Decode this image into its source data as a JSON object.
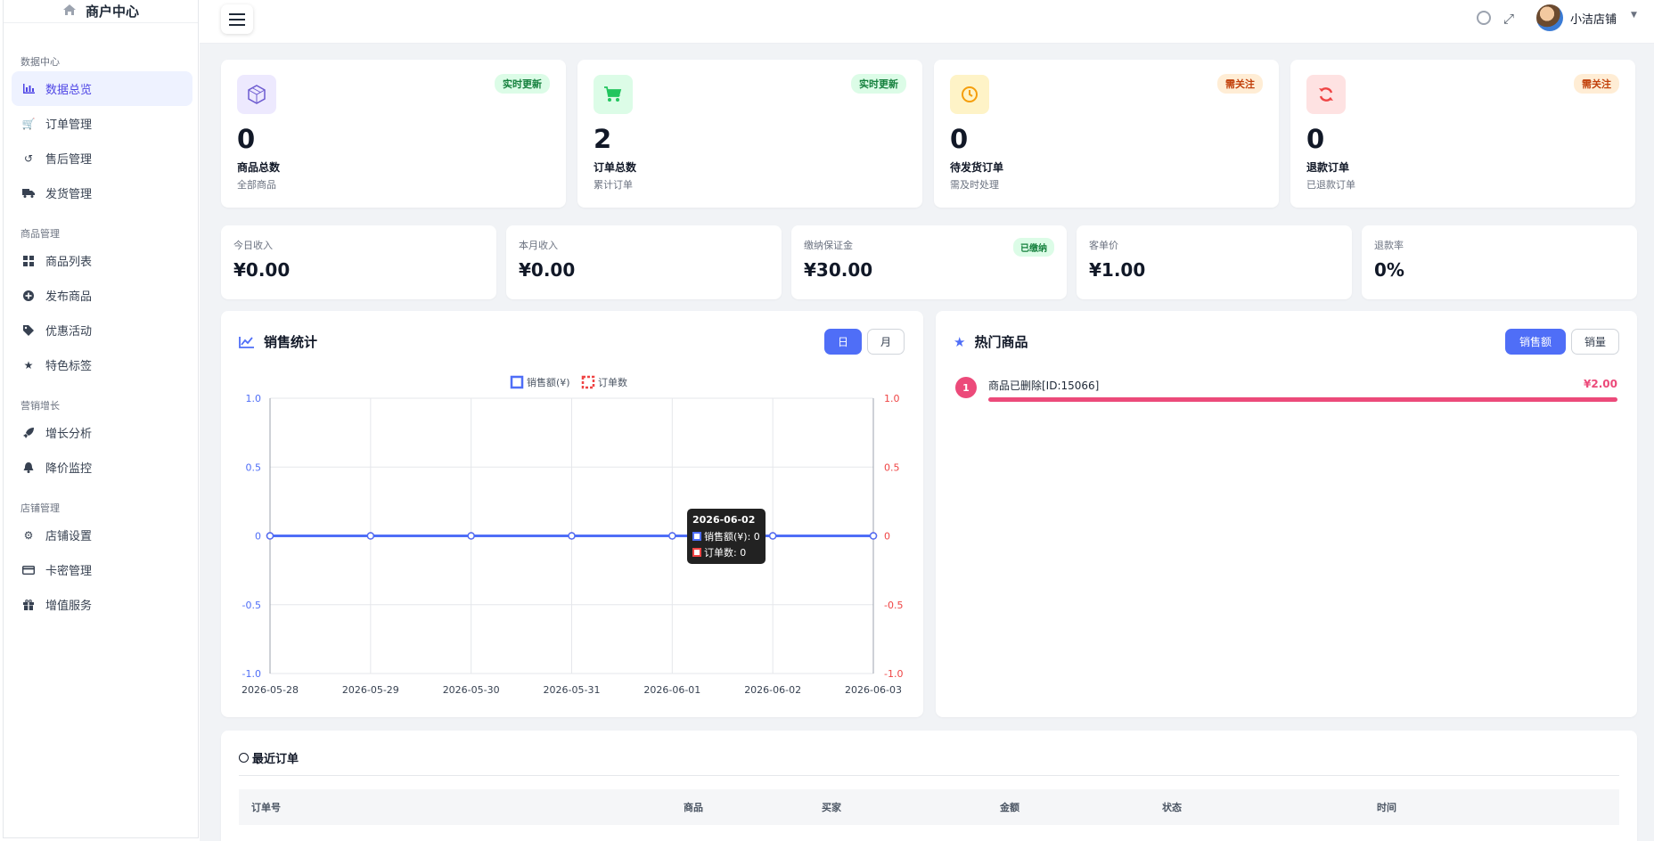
{
  "sidebar": {
    "logo": "商户中心",
    "sections": [
      {
        "title": "数据中心",
        "items": [
          {
            "label": "数据总览",
            "icon": "bar-chart-icon",
            "active": true
          },
          {
            "label": "订单管理",
            "icon": "cart-icon"
          },
          {
            "label": "售后管理",
            "icon": "undo-icon"
          },
          {
            "label": "发货管理",
            "icon": "truck-icon"
          }
        ]
      },
      {
        "title": "商品管理",
        "items": [
          {
            "label": "商品列表",
            "icon": "grid-icon"
          },
          {
            "label": "发布商品",
            "icon": "plus-circle-icon"
          },
          {
            "label": "优惠活动",
            "icon": "tag-icon"
          },
          {
            "label": "特色标签",
            "icon": "star-icon"
          }
        ]
      },
      {
        "title": "营销增长",
        "items": [
          {
            "label": "增长分析",
            "icon": "rocket-icon"
          },
          {
            "label": "降价监控",
            "icon": "bell-icon"
          }
        ]
      },
      {
        "title": "店铺管理",
        "items": [
          {
            "label": "店铺设置",
            "icon": "gear-icon"
          },
          {
            "label": "卡密管理",
            "icon": "card-icon"
          },
          {
            "label": "增值服务",
            "icon": "gift-icon"
          }
        ]
      }
    ]
  },
  "topbar": {
    "user_name": "小洁店铺"
  },
  "stats": [
    {
      "num": "0",
      "label": "商品总数",
      "sub": "全部商品",
      "badge": "实时更新",
      "badge_type": "green",
      "icon": "cube-icon",
      "icon_bg": "#ede9fe",
      "icon_color": "#6d5bd0"
    },
    {
      "num": "2",
      "label": "订单总数",
      "sub": "累计订单",
      "badge": "实时更新",
      "badge_type": "green",
      "icon": "cart-icon",
      "icon_bg": "#dcfce7",
      "icon_color": "#22c55e"
    },
    {
      "num": "0",
      "label": "待发货订单",
      "sub": "需及时处理",
      "badge": "需关注",
      "badge_type": "orange",
      "icon": "clock-icon",
      "icon_bg": "#fef3c7",
      "icon_color": "#f59e0b"
    },
    {
      "num": "0",
      "label": "退款订单",
      "sub": "已退款订单",
      "badge": "需关注",
      "badge_type": "orange",
      "icon": "refresh-icon",
      "icon_bg": "#fee2e2",
      "icon_color": "#ef4444"
    }
  ],
  "revenue": [
    {
      "label": "今日收入",
      "value": "¥0.00"
    },
    {
      "label": "本月收入",
      "value": "¥0.00"
    },
    {
      "label": "缴纳保证金",
      "value": "¥30.00",
      "badge": "已缴纳"
    },
    {
      "label": "客单价",
      "value": "¥1.00"
    },
    {
      "label": "退款率",
      "value": "0%"
    }
  ],
  "sales": {
    "title": "销售统计",
    "btn_day": "日",
    "btn_month": "月",
    "tooltip": {
      "date": "2026-06-02",
      "line1": "销售额(¥): 0",
      "line2": "订单数: 0"
    }
  },
  "chart_data": {
    "type": "line",
    "categories": [
      "2026-05-28",
      "2026-05-29",
      "2026-05-30",
      "2026-05-31",
      "2026-06-01",
      "2026-06-02",
      "2026-06-03"
    ],
    "series": [
      {
        "name": "销售额(¥)",
        "values": [
          0,
          0,
          0,
          0,
          0,
          0,
          0
        ],
        "color": "#4f6ef7",
        "axis": "left"
      },
      {
        "name": "订单数",
        "values": [
          0,
          0,
          0,
          0,
          0,
          0,
          0
        ],
        "color": "#ef4444",
        "axis": "right"
      }
    ],
    "y_ticks": [
      "1.0",
      "0.5",
      "0",
      "-0.5",
      "-1.0"
    ],
    "ylim": [
      -1,
      1
    ],
    "grid": true,
    "legend": "top-center"
  },
  "hot": {
    "title": "热门商品",
    "btn_amount": "销售额",
    "btn_qty": "销量",
    "items": [
      {
        "rank": "1",
        "name": "商品已删除[ID:15066]",
        "value": "¥2.00",
        "fraction": 1.0
      }
    ]
  },
  "orders": {
    "title": "最近订单",
    "columns": [
      "订单号",
      "商品",
      "买家",
      "金额",
      "状态",
      "时间"
    ]
  },
  "colors": {
    "accent": "#4f6ef7",
    "pink": "#ec4a7a",
    "red": "#ef4444"
  }
}
